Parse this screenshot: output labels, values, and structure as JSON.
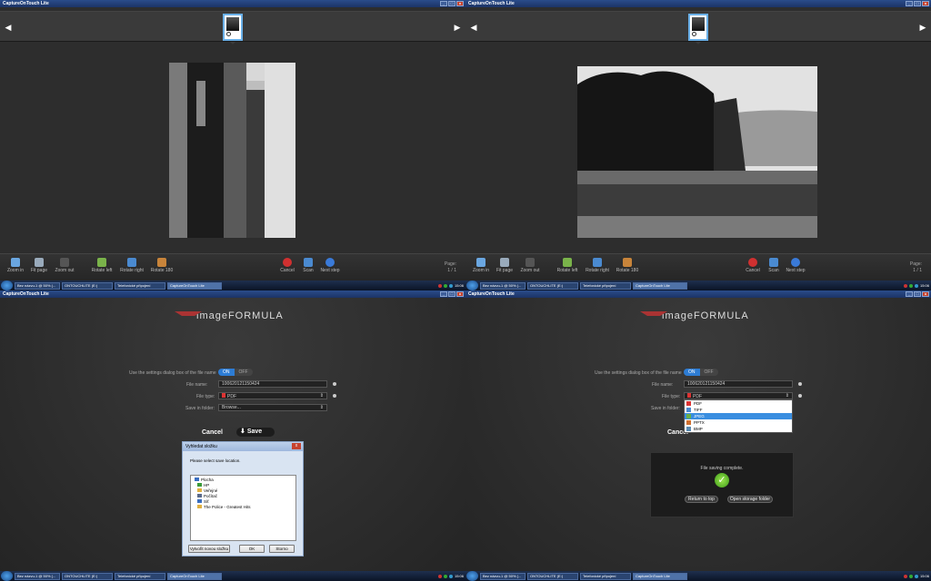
{
  "window_title": "CaptureOnTouch Lite",
  "toolbar": {
    "zoom_in": "Zoom in",
    "fit_page": "Fit page",
    "zoom_out": "Zoom out",
    "rotate_left": "Rotate left",
    "rotate_right": "Rotate right",
    "rotate_180": "Rotate 180",
    "cancel": "Cancel",
    "scan": "Scan",
    "next_step": "Next step",
    "page_label": "Page:",
    "page_value": "1 / 1"
  },
  "taskbar": {
    "tasks": [
      "Bez názvu-1 @ 50% (...",
      "ONTOUCHLITE (E:)",
      "Telefonické připojení",
      "CaptureOnTouch Lite"
    ],
    "clock_top": "15:06",
    "clock_top_right": "15:06",
    "clock_bottom": "15:06"
  },
  "save": {
    "logo": "imageFORMULA",
    "settings_label": "Use the settings dialog box of the file name",
    "toggle_on": "ON",
    "toggle_off": "OFF",
    "file_name_label": "File name:",
    "file_name_value": "100620121150424",
    "file_type_label": "File type:",
    "file_type_value": "PDF",
    "save_in_label": "Save in folder:",
    "save_in_value": "Browse...",
    "cancel": "Cancel",
    "save": "Save"
  },
  "dialog": {
    "title": "Vyhledat složku",
    "prompt": "Please select save location.",
    "tree": [
      "Plocha",
      "HP",
      "Veřejné",
      "Počítač",
      "Síť",
      "The Police - Greatest Hits"
    ],
    "new_folder": "Vytvořit novou složku",
    "ok": "OK",
    "cancel": "Storno"
  },
  "filetype_options": [
    "PDF",
    "TIFF",
    "JPEG",
    "PPTX",
    "BMP"
  ],
  "filetype_selected": "JPEG",
  "complete": {
    "message": "File saving complete.",
    "return": "Return to top",
    "open_folder": "Open storage folder"
  },
  "colors": {
    "accent": "#2d7cd4",
    "title": "#1c3366"
  }
}
